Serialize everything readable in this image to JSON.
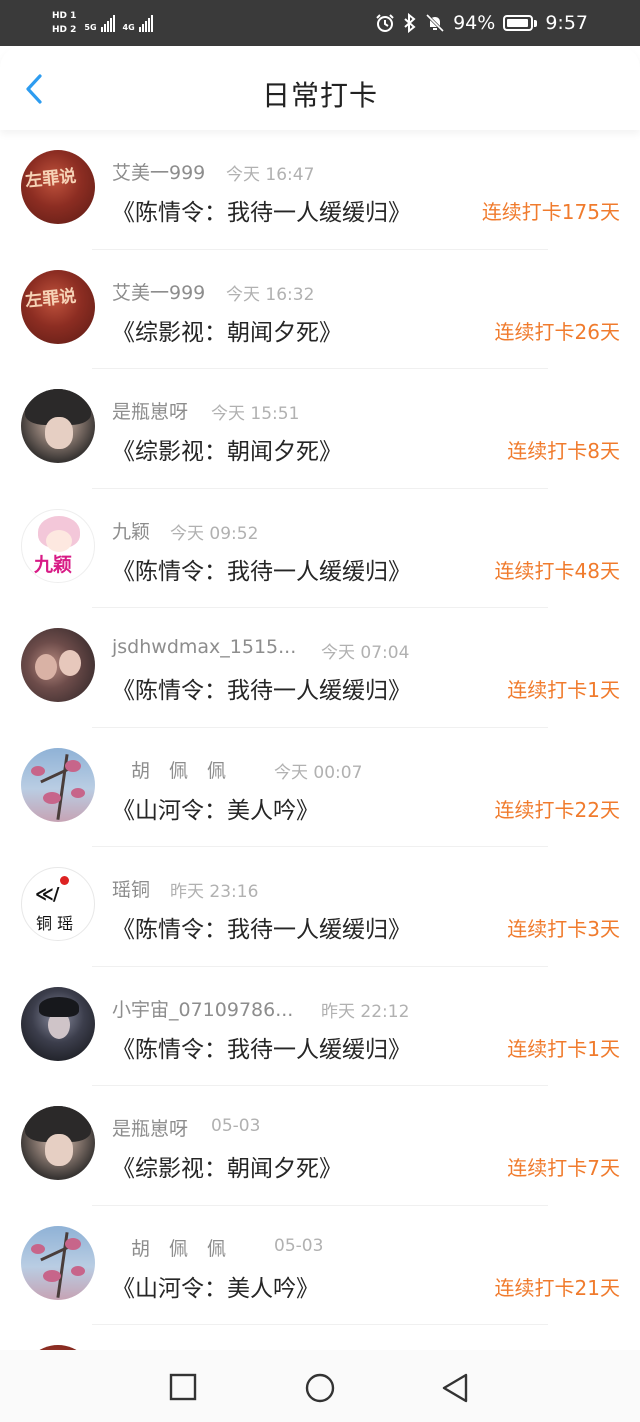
{
  "status_bar": {
    "hd1": "HD 1",
    "hd2": "HD 2",
    "network1": "5G",
    "network2": "4G",
    "battery_percent": "94%",
    "battery_level": 0.94,
    "time": "9:57",
    "icons": [
      "alarm-icon",
      "bluetooth-icon",
      "mute-icon",
      "battery-icon"
    ]
  },
  "header": {
    "title": "日常打卡",
    "back_icon": "chevron-left-icon",
    "accent": "#2d9cf0"
  },
  "entries": [
    {
      "name": "艾美一999",
      "time": "今天 16:47",
      "book": "《陈情令：我待一人缓缓归》",
      "streak": "连续打卡175天",
      "avatar_text": "左罪说"
    },
    {
      "name": "艾美一999",
      "time": "今天 16:32",
      "book": "《综影视：朝闻夕死》",
      "streak": "连续打卡26天",
      "avatar_text": "左罪说"
    },
    {
      "name": "是瓶崽呀",
      "time": "今天 15:51",
      "book": "《综影视：朝闻夕死》",
      "streak": "连续打卡8天"
    },
    {
      "name": "九颖",
      "time": "今天 09:52",
      "book": "《陈情令：我待一人缓缓归》",
      "streak": "连续打卡48天",
      "avatar_text": "九颖"
    },
    {
      "name": "jsdhwdmax_1515...",
      "time": "今天 07:04",
      "book": "《陈情令：我待一人缓缓归》",
      "streak": "连续打卡1天"
    },
    {
      "name": "　胡　佩　佩",
      "time": "今天 00:07",
      "book": "《山河令：美人吟》",
      "streak": "连续打卡22天"
    },
    {
      "name": "瑶铜",
      "time": "昨天 23:16",
      "book": "《陈情令：我待一人缓缓归》",
      "streak": "连续打卡3天",
      "avatar_text": "铜 瑶"
    },
    {
      "name": "小宇宙_07109786...",
      "time": "昨天 22:12",
      "book": "《陈情令：我待一人缓缓归》",
      "streak": "连续打卡1天"
    },
    {
      "name": "是瓶崽呀",
      "time": "05-03",
      "book": "《综影视：朝闻夕死》",
      "streak": "连续打卡7天"
    },
    {
      "name": "　胡　佩　佩",
      "time": "05-03",
      "book": "《山河令：美人吟》",
      "streak": "连续打卡21天"
    }
  ],
  "nav_bar": {
    "buttons": [
      "recents-square-icon",
      "home-circle-icon",
      "back-triangle-icon"
    ]
  },
  "colors": {
    "streak": "#f07b2d",
    "name": "#8d8d8d",
    "time": "#b1b1b1",
    "book": "#262626"
  }
}
